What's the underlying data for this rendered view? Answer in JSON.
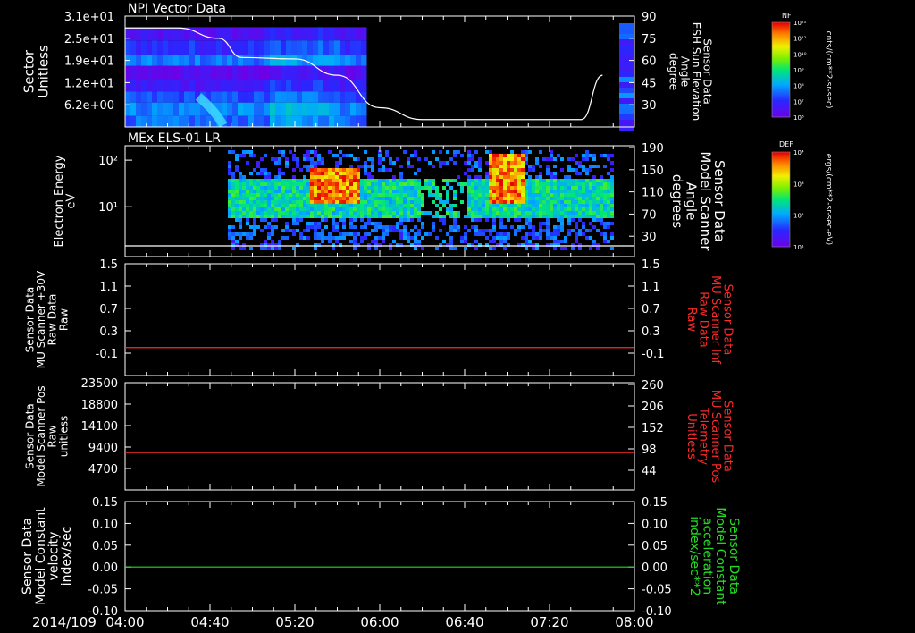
{
  "date_label": "2014/109",
  "time_ticks": [
    "04:00",
    "04:40",
    "05:20",
    "06:00",
    "06:40",
    "07:20",
    "08:00"
  ],
  "colorbars": [
    {
      "label": "NF",
      "unit": "cnts/(cm**2-sr-sec)",
      "tick_labels": [
        "10¹²",
        "10¹¹",
        "10¹⁰",
        "10⁹",
        "10⁸",
        "10⁷",
        "10⁶"
      ]
    },
    {
      "label": "DEF",
      "unit": "ergs/(cm**2-sr-sec-eV)",
      "tick_labels": [
        "10⁴",
        "10³",
        "10²",
        "10¹"
      ]
    }
  ],
  "chart_data": [
    {
      "type": "heatmap",
      "title": "NPI Vector Data",
      "ylabel": [
        "Sector",
        "Unitless"
      ],
      "yticks": [
        "3.1e+01",
        "2.5e+01",
        "1.9e+01",
        "1.2e+01",
        "6.2e+00"
      ],
      "y2label": [
        "Sensor Data",
        "ESH Sun Elevation",
        "Angle",
        "degree"
      ],
      "y2ticks": [
        "90",
        "75",
        "60",
        "45",
        "30"
      ],
      "y2lim": [
        15,
        90
      ],
      "overlay": {
        "x": [
          "04:00",
          "04:25",
          "04:44",
          "04:55",
          "05:20",
          "05:40",
          "06:00",
          "06:20",
          "06:40",
          "07:00",
          "07:20",
          "07:35",
          "07:45"
        ],
        "y": [
          82,
          82,
          75,
          62,
          61,
          50,
          28,
          20,
          20,
          20,
          20,
          20,
          50
        ],
        "color": "#ffffff"
      }
    },
    {
      "type": "heatmap",
      "title": "MEx ELS-01 LR",
      "ylabel": [
        "Electron Energy",
        "eV"
      ],
      "yticks": [
        "10²",
        "10¹"
      ],
      "y2label": [
        "Sensor Data",
        "Model Scanner",
        "Angle",
        "degrees"
      ],
      "y2ticks": [
        "190",
        "150",
        "110",
        "70",
        "30"
      ],
      "overlay": {
        "x": [
          "04:00",
          "08:00"
        ],
        "y": [
          10,
          10
        ],
        "color": "#ffffff"
      }
    },
    {
      "type": "line",
      "ylabel": [
        "Sensor Data",
        "MU Scanner +30V",
        "Raw Data",
        "Raw"
      ],
      "yticks": [
        "1.5",
        "1.1",
        "0.7",
        "0.3",
        "-0.1"
      ],
      "ylim": [
        -0.5,
        1.5
      ],
      "y2label": [
        "Sensor Data",
        "MU Scanner Inf",
        "Raw Data",
        "Raw"
      ],
      "y2label_color": "#ff2a2a",
      "y2ticks": [
        "1.5",
        "1.1",
        "0.7",
        "0.3",
        "-0.1"
      ],
      "series": [
        {
          "x": [
            "04:00",
            "08:00"
          ],
          "y": [
            0,
            0
          ],
          "color": "#ff2a2a"
        }
      ]
    },
    {
      "type": "line",
      "ylabel": [
        "Sensor Data",
        "Model Scanner Pos",
        "Raw",
        "unitless"
      ],
      "yticks": [
        "23500",
        "18800",
        "14100",
        "9400",
        "4700"
      ],
      "ylim": [
        0,
        23500
      ],
      "y2label": [
        "Sensor Data",
        "MU Scanner Pos",
        "Telemetry",
        "Unitless"
      ],
      "y2label_color": "#ff2a2a",
      "y2ticks": [
        "260",
        "206",
        "152",
        "98",
        "44"
      ],
      "series": [
        {
          "x": [
            "04:00",
            "08:00"
          ],
          "y": [
            8200,
            8200
          ],
          "color": "#ff2a2a"
        }
      ]
    },
    {
      "type": "line",
      "ylabel": [
        "Sensor Data",
        "Model Constant",
        "velocity",
        "index/sec"
      ],
      "yticks": [
        "0.15",
        "0.10",
        "0.05",
        "0.00",
        "-0.05",
        "-0.10"
      ],
      "ylim": [
        -0.1,
        0.15
      ],
      "y2label": [
        "Sensor Data",
        "Model Constant",
        "acceleration",
        "index/sec**2"
      ],
      "y2label_color": "#22dd22",
      "y2ticks": [
        "0.15",
        "0.10",
        "0.05",
        "0.00",
        "-0.05",
        "-0.10"
      ],
      "series": [
        {
          "x": [
            "04:00",
            "08:00"
          ],
          "y": [
            0,
            0
          ],
          "color": "#22dd22"
        }
      ]
    }
  ]
}
